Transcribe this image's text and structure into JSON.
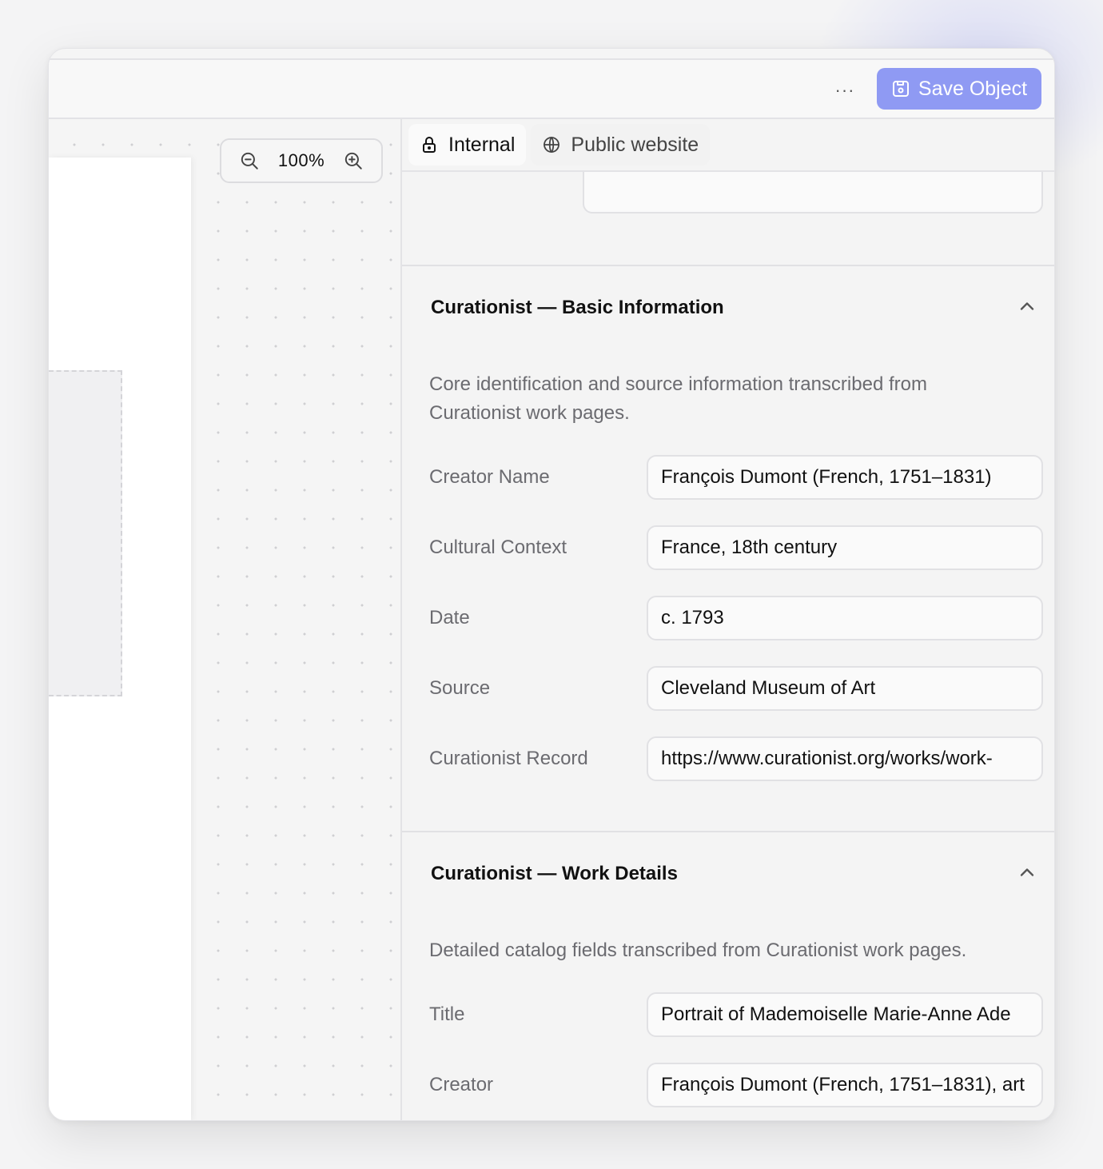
{
  "toolbar": {
    "more_icon": "more-horizontal-icon",
    "save_label": "Save Object",
    "save_color": "#8f9af3"
  },
  "canvas": {
    "zoom_label": "100%"
  },
  "tabs": [
    {
      "label": "Internal",
      "icon": "lock-icon",
      "active": true
    },
    {
      "label": "Public website",
      "icon": "globe-icon",
      "active": false
    }
  ],
  "sections": [
    {
      "title": "Curationist — Basic Information",
      "description": "Core identification and source information transcribed from Curationist work pages.",
      "fields": [
        {
          "label": "Creator Name",
          "value": "François Dumont (French, 1751–1831)"
        },
        {
          "label": "Cultural Context",
          "value": "France, 18th century"
        },
        {
          "label": "Date",
          "value": "c. 1793"
        },
        {
          "label": "Source",
          "value": "Cleveland Museum of Art"
        },
        {
          "label": "Curationist Record",
          "value": "https://www.curationist.org/works/work-"
        }
      ]
    },
    {
      "title": "Curationist — Work Details",
      "description": "Detailed catalog fields transcribed from Curationist work pages.",
      "fields": [
        {
          "label": "Title",
          "value": "Portrait of Mademoiselle Marie-Anne Ade"
        },
        {
          "label": "Creator",
          "value": "François Dumont (French, 1751–1831), art"
        }
      ]
    }
  ]
}
